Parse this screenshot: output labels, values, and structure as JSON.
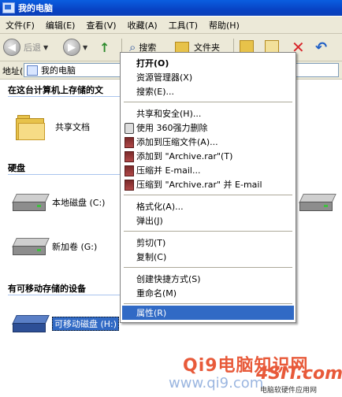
{
  "window": {
    "title": "我的电脑"
  },
  "menubar": {
    "items": [
      "文件(F)",
      "编辑(E)",
      "查看(V)",
      "收藏(A)",
      "工具(T)",
      "帮助(H)"
    ]
  },
  "toolbar": {
    "back_label": "后退",
    "search_label": "搜索",
    "folders_label": "文件夹"
  },
  "address": {
    "label": "地址(D)",
    "value": "我的电脑"
  },
  "content": {
    "section_stored": "在这台计算机上存储的文",
    "shared_docs": "共享文档",
    "section_hdd": "硬盘",
    "local_disk": "本地磁盘 (C:)",
    "new_volume": "新加卷 (G:)",
    "section_removable": "有可移动存储的设备",
    "removable_disk": "可移动磁盘 (H:)"
  },
  "context_menu": {
    "items": [
      "打开(O)",
      "资源管理器(X)",
      "搜索(E)...",
      "共享和安全(H)...",
      "使用 360强力删除",
      "添加到压缩文件(A)...",
      "添加到 \"Archive.rar\"(T)",
      "压缩并 E-mail...",
      "压缩到 \"Archive.rar\" 并 E-mail",
      "格式化(A)...",
      "弹出(J)",
      "剪切(T)",
      "复制(C)",
      "创建快捷方式(S)",
      "重命名(M)",
      "属性(R)"
    ]
  },
  "watermark": {
    "line1": "Qi9电脑知识网",
    "line2": "www.qi9.com",
    "brand": "4SIT.com",
    "brand_sub": "电脑软硬件应用网"
  }
}
